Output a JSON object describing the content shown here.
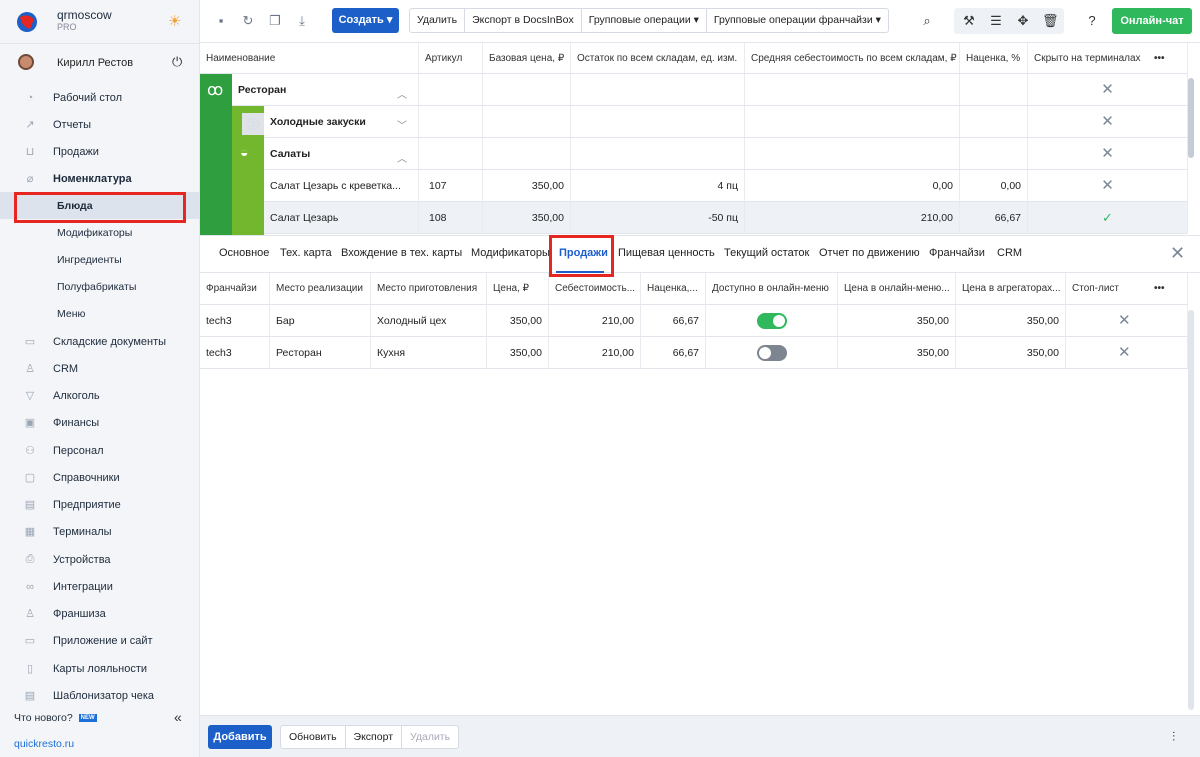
{
  "brand": {
    "name": "qrmoscow",
    "plan": "PRO"
  },
  "user": {
    "name": "Кирилл Рестов"
  },
  "sidebar": {
    "items": [
      {
        "label": "Рабочий стол",
        "icon": "dashboard-icon"
      },
      {
        "label": "Отчеты",
        "icon": "reports-icon"
      },
      {
        "label": "Продажи",
        "icon": "cart-icon"
      },
      {
        "label": "Номенклатура",
        "icon": "tag-icon"
      },
      {
        "label": "Блюда"
      },
      {
        "label": "Модификаторы"
      },
      {
        "label": "Ингредиенты"
      },
      {
        "label": "Полуфабрикаты"
      },
      {
        "label": "Меню"
      },
      {
        "label": "Складские документы",
        "icon": "warehouse-icon"
      },
      {
        "label": "CRM",
        "icon": "crm-icon"
      },
      {
        "label": "Алкоголь",
        "icon": "alcohol-icon"
      },
      {
        "label": "Финансы",
        "icon": "wallet-icon"
      },
      {
        "label": "Персонал",
        "icon": "people-icon"
      },
      {
        "label": "Справочники",
        "icon": "book-icon"
      },
      {
        "label": "Предприятие",
        "icon": "building-icon"
      },
      {
        "label": "Терминалы",
        "icon": "terminal-icon"
      },
      {
        "label": "Устройства",
        "icon": "printer-icon"
      },
      {
        "label": "Интеграции",
        "icon": "link-icon"
      },
      {
        "label": "Франшиза",
        "icon": "franchise-icon"
      },
      {
        "label": "Приложение и сайт",
        "icon": "app-icon"
      },
      {
        "label": "Карты лояльности",
        "icon": "card-icon"
      },
      {
        "label": "Шаблонизатор чека",
        "icon": "receipt-icon"
      }
    ],
    "whats_new": "Что нового?",
    "new_badge": "NEW",
    "site": "quickresto.ru"
  },
  "toolbar": {
    "create": "Создать",
    "delete": "Удалить",
    "export_docs": "Экспорт в DocsInBox",
    "group_ops": "Групповые операции",
    "group_ops_fr": "Групповые операции франчайзи",
    "chat": "Онлайн-чат"
  },
  "top_table": {
    "headers": [
      "Наименование",
      "Артикул",
      "Базовая цена, ₽",
      "Остаток по всем складам, ед. изм.",
      "Средняя себестоимость по всем складам, ₽",
      "Наценка, %",
      "Скрыто на терминалах"
    ],
    "rows": [
      {
        "name": "Ресторан",
        "article": "",
        "price": "",
        "stock": "",
        "cost": "",
        "markup": "",
        "hidden": "✕"
      },
      {
        "name": "Холодные закуски",
        "article": "",
        "price": "",
        "stock": "",
        "cost": "",
        "markup": "",
        "hidden": "✕"
      },
      {
        "name": "Салаты",
        "article": "",
        "price": "",
        "stock": "",
        "cost": "",
        "markup": "",
        "hidden": "✕"
      },
      {
        "name": "Салат Цезарь с креветка...",
        "article": "107",
        "price": "350,00",
        "stock": "4 пц",
        "cost": "0,00",
        "markup": "0,00",
        "hidden": "✕"
      },
      {
        "name": "Салат Цезарь",
        "article": "108",
        "price": "350,00",
        "stock": "-50 пц",
        "cost": "210,00",
        "markup": "66,67",
        "hidden": "✓"
      }
    ]
  },
  "tabs": [
    "Основное",
    "Тех. карта",
    "Вхождение в тех. карты",
    "Модификаторы",
    "Продажи",
    "Пищевая ценность",
    "Текущий остаток",
    "Отчет по движению",
    "Франчайзи",
    "CRM"
  ],
  "bottom_table": {
    "headers": [
      "Франчайзи",
      "Место реализации",
      "Место приготовления",
      "Цена, ₽",
      "Себестоимость...",
      "Наценка,...",
      "Доступно в онлайн-меню",
      "Цена в онлайн-меню...",
      "Цена в агрегаторах...",
      "Стоп-лист"
    ],
    "rows": [
      {
        "franchisee": "tech3",
        "place": "Бар",
        "prep": "Холодный цех",
        "price": "350,00",
        "cost": "210,00",
        "markup": "66,67",
        "online": true,
        "online_price": "350,00",
        "agg_price": "350,00",
        "stop": "✕"
      },
      {
        "franchisee": "tech3",
        "place": "Ресторан",
        "prep": "Кухня",
        "price": "350,00",
        "cost": "210,00",
        "markup": "66,67",
        "online": false,
        "online_price": "350,00",
        "agg_price": "350,00",
        "stop": "✕"
      }
    ]
  },
  "bottom_bar": {
    "add": "Добавить",
    "refresh": "Обновить",
    "export": "Экспорт",
    "delete": "Удалить"
  },
  "colors": {
    "accent": "#1c5fc9",
    "success": "#2fb85c",
    "highlight": "#e52621"
  }
}
